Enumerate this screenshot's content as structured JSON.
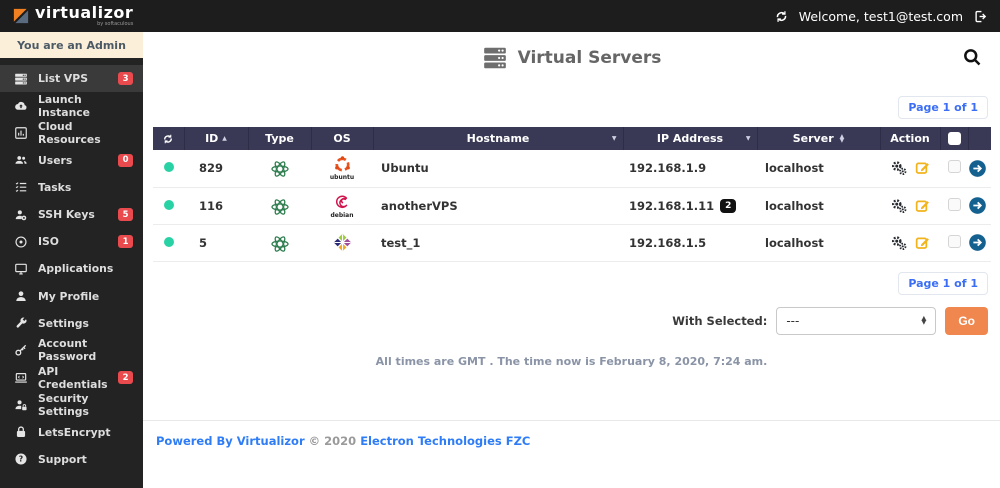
{
  "topbar": {
    "logo_text": "virtualizor",
    "logo_subtext": "by softaculous",
    "welcome_text": "Welcome, test1@test.com"
  },
  "sidebar": {
    "admin_banner": "You are an Admin",
    "items": [
      {
        "label": "List VPS",
        "icon": "servers-icon",
        "badge": "3",
        "active": true
      },
      {
        "label": "Launch Instance",
        "icon": "cloud-upload-icon"
      },
      {
        "label": "Cloud Resources",
        "icon": "chart-icon"
      },
      {
        "label": "Users",
        "icon": "users-icon",
        "badge": "0"
      },
      {
        "label": "Tasks",
        "icon": "tasks-icon"
      },
      {
        "label": "SSH Keys",
        "icon": "ssh-key-icon",
        "badge": "5"
      },
      {
        "label": "ISO",
        "icon": "disc-icon",
        "badge": "1"
      },
      {
        "label": "Applications",
        "icon": "monitor-icon"
      },
      {
        "label": "My Profile",
        "icon": "user-icon"
      },
      {
        "label": "Settings",
        "icon": "wrench-icon"
      },
      {
        "label": "Account Password",
        "icon": "key-icon"
      },
      {
        "label": "API Credentials",
        "icon": "laptop-icon",
        "badge": "2"
      },
      {
        "label": "Security Settings",
        "icon": "user-lock-icon"
      },
      {
        "label": "LetsEncrypt",
        "icon": "padlock-icon"
      },
      {
        "label": "Support",
        "icon": "question-icon"
      }
    ]
  },
  "main": {
    "title": "Virtual Servers",
    "pagination": "Page 1 of 1",
    "table": {
      "columns": [
        {
          "label": "",
          "type": "refresh"
        },
        {
          "label": "ID",
          "sort": "asc"
        },
        {
          "label": "Type"
        },
        {
          "label": "OS"
        },
        {
          "label": "Hostname",
          "filter": true
        },
        {
          "label": "IP Address",
          "filter": true
        },
        {
          "label": "Server",
          "sort": "both"
        },
        {
          "label": "Action"
        },
        {
          "label": "",
          "type": "checkbox"
        },
        {
          "label": "",
          "type": "spacer"
        }
      ],
      "rows": [
        {
          "status": "running",
          "id": "829",
          "type": "kvm",
          "os": "ubuntu",
          "os_label": "ubuntu",
          "hostname": "Ubuntu",
          "ip": "192.168.1.9",
          "ip_count": "",
          "server": "localhost"
        },
        {
          "status": "running",
          "id": "116",
          "type": "kvm",
          "os": "debian",
          "os_label": "debian",
          "hostname": "anotherVPS",
          "ip": "192.168.1.11",
          "ip_count": "2",
          "server": "localhost"
        },
        {
          "status": "running",
          "id": "5",
          "type": "kvm",
          "os": "centos",
          "os_label": "",
          "hostname": "test_1",
          "ip": "192.168.1.5",
          "ip_count": "",
          "server": "localhost"
        }
      ]
    },
    "with_selected": {
      "label": "With Selected:",
      "value": "---",
      "go": "Go"
    },
    "time_note": "All times are GMT . The time now is February 8, 2020, 7:24 am.",
    "footer": {
      "powered_by": "Powered By Virtualizor",
      "copyright": "© 2020",
      "company": "Electron Technologies FZC"
    }
  },
  "colors": {
    "accent_blue": "#3b6ef5",
    "go_orange": "#f0874f",
    "badge_red": "#e94a4e",
    "status_green": "#29d2a4",
    "table_header_navy": "#393956",
    "edit_amber": "#f2b41d",
    "open_arrow_blue": "#14618f",
    "admin_banner_cream": "#fbefd9"
  }
}
